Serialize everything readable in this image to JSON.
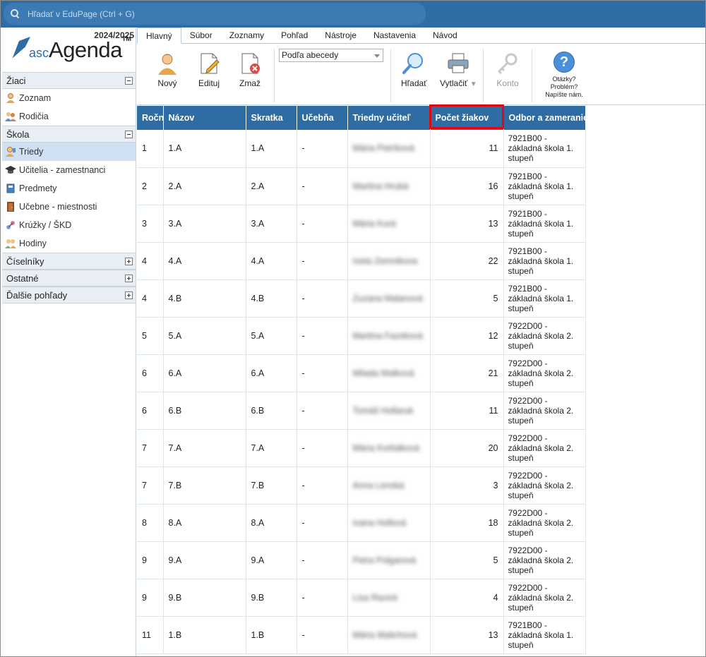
{
  "search": {
    "placeholder": "Hľadať v EduPage (Ctrl + G)"
  },
  "sidebar": {
    "year": "2024/2025",
    "logo": {
      "asc": "asc",
      "agenda": "Agenda",
      "tm": "TM"
    },
    "sections": [
      {
        "label": "Žiaci",
        "expanded": true,
        "items": [
          {
            "label": "Zoznam",
            "icon": "student-icon"
          },
          {
            "label": "Rodičia",
            "icon": "parents-icon"
          }
        ]
      },
      {
        "label": "Škola",
        "expanded": true,
        "items": [
          {
            "label": "Triedy",
            "icon": "class-icon",
            "active": true
          },
          {
            "label": "Učitelia - zamestnanci",
            "icon": "graduation-cap-icon"
          },
          {
            "label": "Predmety",
            "icon": "book-icon"
          },
          {
            "label": "Učebne - miestnosti",
            "icon": "door-icon"
          },
          {
            "label": "Krúžky / ŠKD",
            "icon": "clubs-icon"
          },
          {
            "label": "Hodiny",
            "icon": "lessons-icon"
          }
        ]
      },
      {
        "label": "Číselníky",
        "expanded": false
      },
      {
        "label": "Ostatné",
        "expanded": false
      },
      {
        "label": "Ďalšie pohľady",
        "expanded": false
      }
    ]
  },
  "tabs": [
    "Hlavný",
    "Súbor",
    "Zoznamy",
    "Pohľad",
    "Nástroje",
    "Nastavenia",
    "Návod"
  ],
  "toolbar": {
    "new_label": "Nový",
    "edit_label": "Edituj",
    "delete_label": "Zmaž",
    "sort_value": "Podľa abecedy",
    "search_label": "Hľadať",
    "print_label": "Vytlačiť",
    "account_label": "Konto",
    "help_line1": "Otázky?",
    "help_line2": "Problém?",
    "help_line3": "Napíšte nám."
  },
  "table": {
    "columns": [
      "Ročník",
      "Názov",
      "Skratka",
      "Učebňa",
      "Triedny učiteľ",
      "Počet žiakov",
      "Odbor a zameranie"
    ],
    "rows": [
      [
        "1",
        "1.A",
        "1.A",
        "-",
        "Mária Petríková",
        "11",
        "7921B00 -\nzákladná škola 1.\nstupeň"
      ],
      [
        "2",
        "2.A",
        "2.A",
        "-",
        "Martina Hrubá",
        "16",
        "7921B00 -\nzákladná škola 1.\nstupeň"
      ],
      [
        "3",
        "3.A",
        "3.A",
        "-",
        "Mária Kurá",
        "13",
        "7921B00 -\nzákladná škola 1.\nstupeň"
      ],
      [
        "4",
        "4.A",
        "4.A",
        "-",
        "Iveta Zemnikova",
        "22",
        "7921B00 -\nzákladná škola 1.\nstupeň"
      ],
      [
        "4",
        "4.B",
        "4.B",
        "-",
        "Zuzana Malanová",
        "5",
        "7921B00 -\nzákladná škola 1.\nstupeň"
      ],
      [
        "5",
        "5.A",
        "5.A",
        "-",
        "Martina Fazeková",
        "12",
        "7922D00 -\nzákladná škola 2.\nstupeň"
      ],
      [
        "6",
        "6.A",
        "6.A",
        "-",
        "Milada Malková",
        "21",
        "7922D00 -\nzákladná škola 2.\nstupeň"
      ],
      [
        "6",
        "6.B",
        "6.B",
        "-",
        "Tomáš Hollaruk",
        "11",
        "7922D00 -\nzákladná škola 2.\nstupeň"
      ],
      [
        "7",
        "7.A",
        "7.A",
        "-",
        "Mária Korbáková",
        "20",
        "7922D00 -\nzákladná škola 2.\nstupeň"
      ],
      [
        "7",
        "7.B",
        "7.B",
        "-",
        "Anna Lenská",
        "3",
        "7922D00 -\nzákladná škola 2.\nstupeň"
      ],
      [
        "8",
        "8.A",
        "8.A",
        "-",
        "Ivana Hollová",
        "18",
        "7922D00 -\nzákladná škola 2.\nstupeň"
      ],
      [
        "9",
        "9.A",
        "9.A",
        "-",
        "Petra Polgarová",
        "5",
        "7922D00 -\nzákladná škola 2.\nstupeň"
      ],
      [
        "9",
        "9.B",
        "9.B",
        "-",
        "Lisa Ravick",
        "4",
        "7922D00 -\nzákladná škola 2.\nstupeň"
      ],
      [
        "11",
        "1.B",
        "1.B",
        "-",
        "Mária Malichová",
        "13",
        "7921B00 -\nzákladná škola 1.\nstupeň"
      ]
    ]
  },
  "colors": {
    "accent": "#2e6da4",
    "highlight": "#e30613"
  }
}
